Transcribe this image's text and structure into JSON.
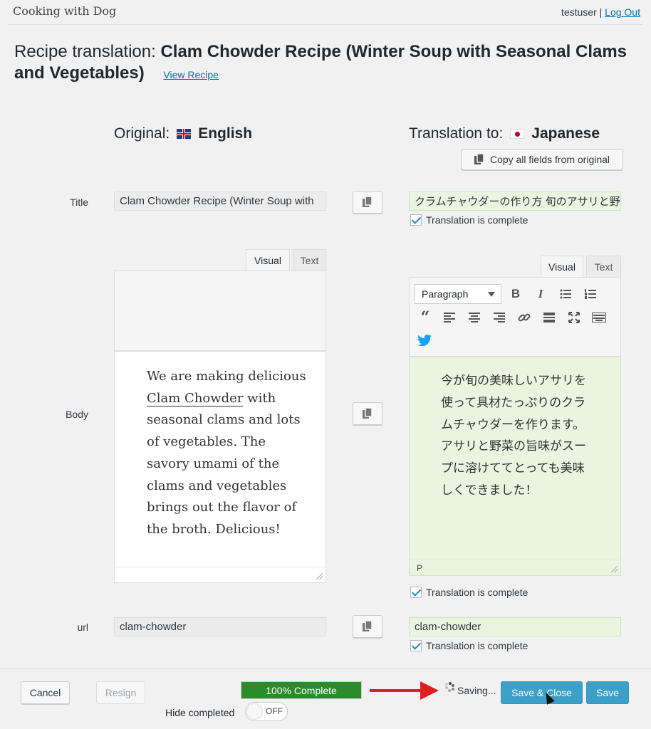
{
  "site": {
    "title": "Cooking with Dog"
  },
  "user": {
    "name": "testuser",
    "separator": "|",
    "logout_label": "Log Out"
  },
  "page": {
    "title_prefix": "Recipe translation:",
    "title_main": "Clam Chowder Recipe (Winter Soup with Seasonal Clams and Vegetables)",
    "view_link": "View Recipe"
  },
  "original": {
    "label": "Original:",
    "language": "English",
    "flag_icon": "uk-flag-icon"
  },
  "translation": {
    "label": "Translation to:",
    "language": "Japanese",
    "flag_icon": "japan-flag-icon"
  },
  "copy_all_label": "Copy all fields from original",
  "fields": {
    "title": {
      "label": "Title",
      "original": "Clam Chowder Recipe (Winter Soup with",
      "translation": "クラムチャウダーの作り方 旬のアサリと野菜",
      "complete_label": "Translation is complete"
    },
    "body": {
      "label": "Body",
      "tab_visual": "Visual",
      "tab_text": "Text",
      "original_pre": "We are making delicious ",
      "original_link": "Clam Chowder",
      "original_post": " with seasonal clams and lots of vegetables. The savory umami of the clams and vegetables brings out the flavor of the broth. Delicious!",
      "translation": "今が旬の美味しいアサリを使って具材たっぷりのクラムチャウダーを作ります。アサリと野菜の旨味がスープに溶けててとっても美味しくできました！",
      "format_select": "Paragraph",
      "status_path": "P",
      "complete_label": "Translation is complete"
    },
    "url": {
      "label": "url",
      "original": "clam-chowder",
      "translation": "clam-chowder",
      "complete_label": "Translation is complete"
    }
  },
  "footer": {
    "cancel_label": "Cancel",
    "resign_label": "Resign",
    "progress_label": "100% Complete",
    "progress_value": 100,
    "progress_color": "#2a8c2a",
    "hide_completed_label": "Hide completed",
    "toggle_state": "OFF",
    "saving_label": "Saving...",
    "save_close_label": "Save & Close",
    "save_label": "Save"
  },
  "colors": {
    "accent": "#0085ba",
    "link": "#0073aa",
    "translated_bg": "#e9f5e1",
    "arrow": "#e02020"
  }
}
